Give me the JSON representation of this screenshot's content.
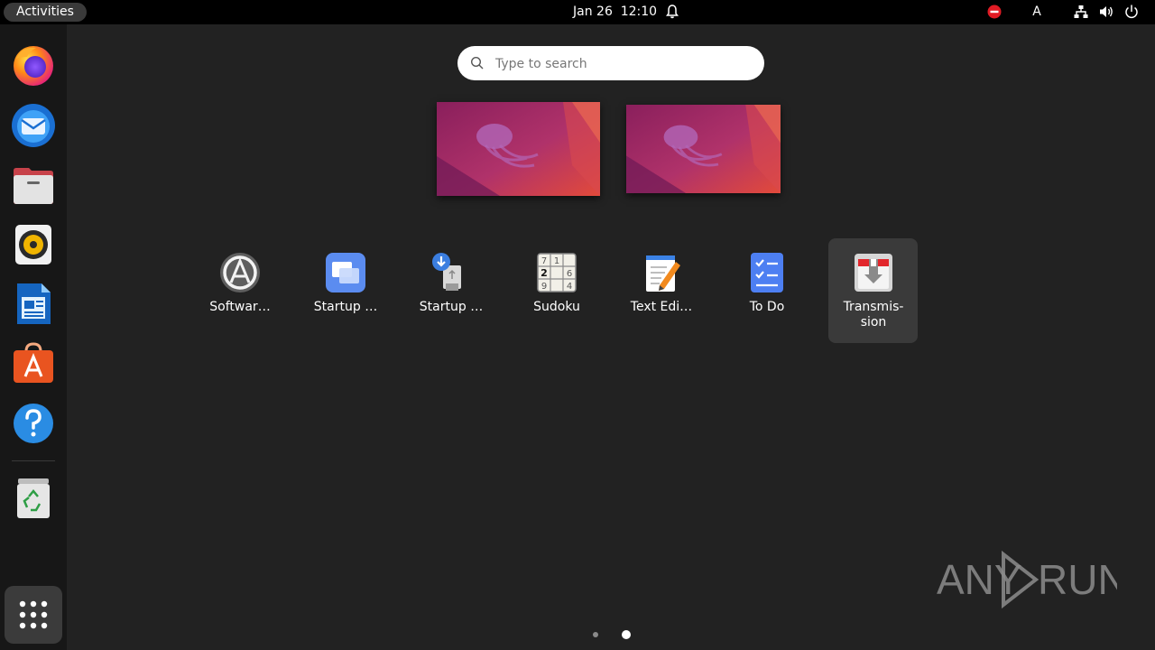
{
  "topbar": {
    "activities_label": "Activities",
    "clock": "Jan 26  12:10",
    "icons": [
      "notifications-bell-icon",
      "do-not-disturb-icon",
      "keyboard-layout-indicator",
      "network-icon",
      "volume-icon",
      "power-icon"
    ],
    "keyboard_layout": "A"
  },
  "dock": {
    "items": [
      {
        "name": "firefox",
        "icon": "firefox-icon"
      },
      {
        "name": "thunderbird",
        "icon": "thunderbird-icon"
      },
      {
        "name": "files",
        "icon": "files-icon"
      },
      {
        "name": "rhythmbox",
        "icon": "rhythmbox-icon"
      },
      {
        "name": "libreoffice-writer",
        "icon": "writer-icon"
      },
      {
        "name": "ubuntu-software",
        "icon": "software-icon"
      },
      {
        "name": "help",
        "icon": "help-icon"
      },
      {
        "name": "trash",
        "icon": "trash-icon"
      }
    ],
    "show_apps_icon": "app-grid-icon"
  },
  "search": {
    "placeholder": "Type to search"
  },
  "workspaces": {
    "count": 2
  },
  "app_grid": {
    "apps": [
      {
        "label": "Softwar…",
        "icon": "software-updater-icon"
      },
      {
        "label": "Startup …",
        "icon": "startup-applications-icon"
      },
      {
        "label": "Startup …",
        "icon": "startup-disk-creator-icon"
      },
      {
        "label": "Sudoku",
        "icon": "sudoku-icon",
        "digits": [
          "7",
          "1",
          "2",
          "6",
          "9",
          "4"
        ]
      },
      {
        "label": "Text Edi…",
        "icon": "text-editor-icon"
      },
      {
        "label": "To Do",
        "icon": "todo-icon"
      },
      {
        "label": "Transmis-\nsion",
        "icon": "transmission-icon",
        "selected": true
      }
    ],
    "pages": 2,
    "current_page": 2
  },
  "watermark": {
    "text_left": "ANY",
    "text_right": "RUN"
  },
  "colors": {
    "background": "#222222",
    "topbar": "#000000",
    "dock": "#171717",
    "ubuntu_orange": "#e95420"
  }
}
